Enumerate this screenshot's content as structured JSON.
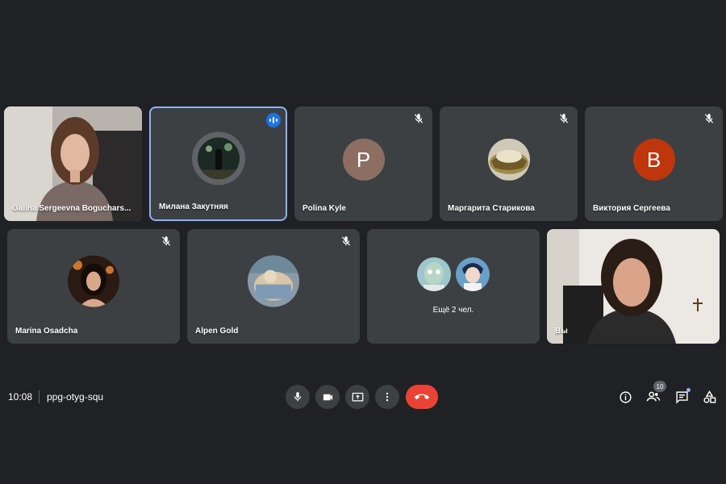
{
  "meeting": {
    "time": "10:08",
    "code": "ppg-otyg-squ"
  },
  "colors": {
    "background": "#202124",
    "tile": "#3c4043",
    "active_border": "#8ab4f8",
    "hangup": "#ea4335",
    "avatar_p": "#8d6e63",
    "avatar_b": "#bf360c"
  },
  "participants": [
    {
      "name": "Galina Sergeevna Boguchars...",
      "video": true,
      "muted": false
    },
    {
      "name": "Милана Закутняя",
      "video": false,
      "speaking": true
    },
    {
      "name": "Polina Kyle",
      "video": false,
      "muted": true,
      "initial": "P"
    },
    {
      "name": "Маргарита Старикова",
      "video": false,
      "muted": true
    },
    {
      "name": "Виктория Сергеева",
      "video": false,
      "muted": true,
      "initial": "B"
    },
    {
      "name": "Marina Osadcha",
      "video": false,
      "muted": true
    },
    {
      "name": "Alpen Gold",
      "video": false,
      "muted": true
    },
    {
      "name": "Вы",
      "video": true,
      "muted": false
    }
  ],
  "more_tile": {
    "label": "Ещё 2 чел."
  },
  "participants_count": "10",
  "controls": {
    "mic": "mic-icon",
    "camera": "camera-icon",
    "present": "present-screen-icon",
    "more": "more-options-icon",
    "hangup": "hang-up-icon"
  }
}
